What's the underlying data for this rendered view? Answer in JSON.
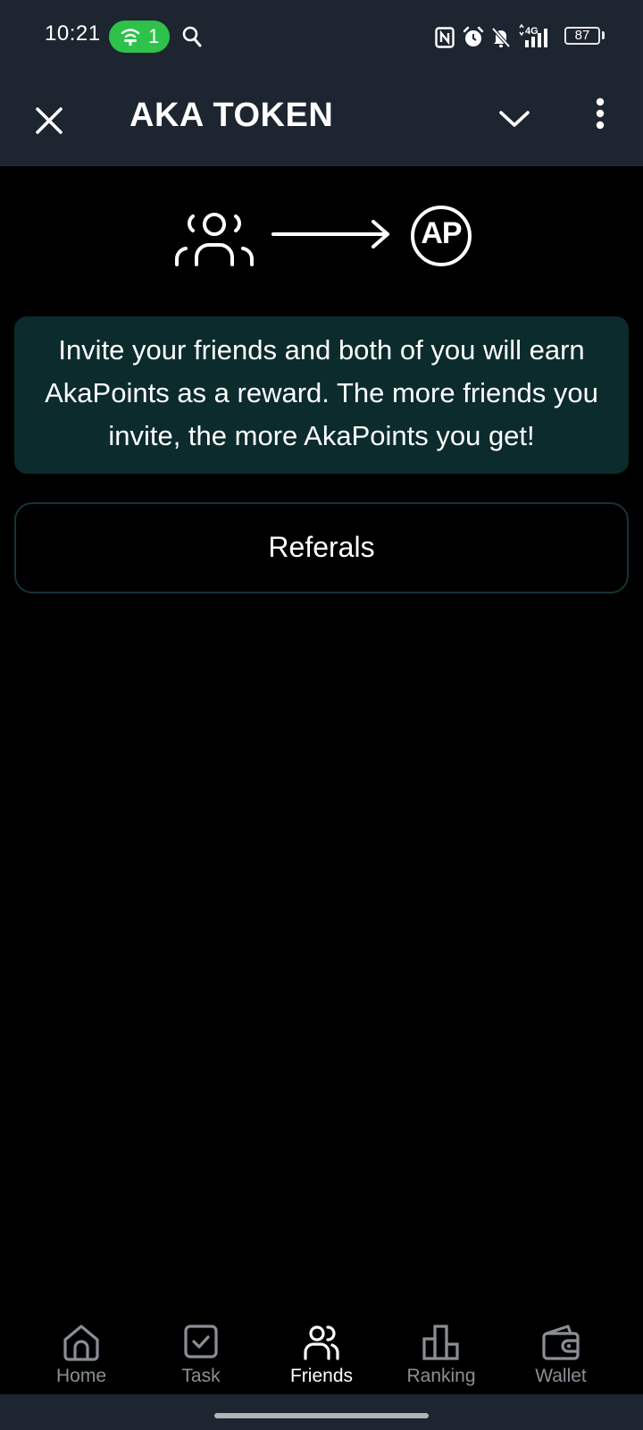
{
  "status_bar": {
    "time": "10:21",
    "hotspot_count": "1",
    "network_label": "4G",
    "battery_level": "87"
  },
  "header": {
    "title": "AKA TOKEN"
  },
  "hero": {
    "points_badge": "AP"
  },
  "info": {
    "text": "Invite your friends and both of you will earn AkaPoints as a reward. The more friends you invite, the more AkaPoints you get!"
  },
  "referals_button": {
    "label": "Referals"
  },
  "bottom_nav": {
    "active": "Friends",
    "items": [
      {
        "label": "Home",
        "icon": "home-icon"
      },
      {
        "label": "Task",
        "icon": "task-icon"
      },
      {
        "label": "Friends",
        "icon": "friends-icon"
      },
      {
        "label": "Ranking",
        "icon": "ranking-icon"
      },
      {
        "label": "Wallet",
        "icon": "wallet-icon"
      }
    ]
  },
  "colors": {
    "header_bg": "#1d2530",
    "card_bg": "#0c2b2d",
    "button_border": "#163437",
    "hotspot_green": "#2ec24a",
    "nav_inactive": "#8a8f95",
    "nav_active": "#ffffff"
  }
}
